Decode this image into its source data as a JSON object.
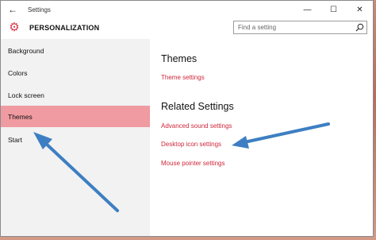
{
  "window": {
    "title": "Settings",
    "back_icon": "back-arrow-icon",
    "controls": [
      "minimize-icon",
      "maximize-icon",
      "close-icon"
    ]
  },
  "header": {
    "icon": "gear-icon",
    "section_title": "PERSONALIZATION",
    "search_placeholder": "Find a setting",
    "search_icon": "search-icon"
  },
  "sidebar": {
    "items": [
      {
        "label": "Background"
      },
      {
        "label": "Colors"
      },
      {
        "label": "Lock screen"
      },
      {
        "label": "Themes",
        "selected": true
      },
      {
        "label": "Start"
      }
    ]
  },
  "content": {
    "themes_heading": "Themes",
    "theme_settings_link": "Theme settings",
    "related_heading": "Related Settings",
    "related_links": [
      "Advanced sound settings",
      "Desktop icon settings",
      "Mouse pointer settings"
    ]
  },
  "colors": {
    "accent": "#d0273a",
    "selected_bg": "#f09aa1",
    "sidebar_bg": "#f2f2f2",
    "annotation_arrow": "#3d7fc2"
  }
}
